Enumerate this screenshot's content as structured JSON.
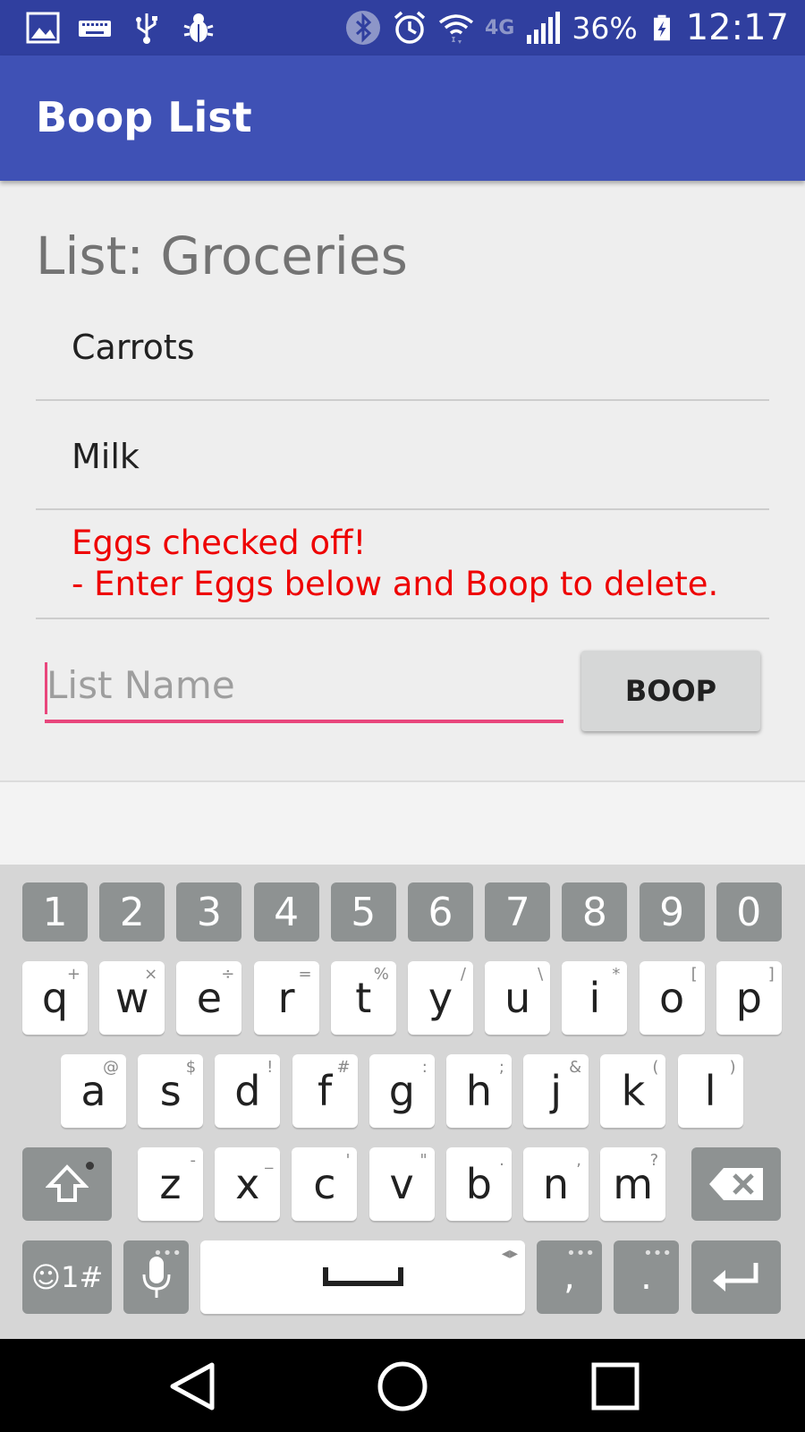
{
  "status_bar": {
    "left_icons": [
      "image-icon",
      "keyboard-icon",
      "usb-icon",
      "bug-icon"
    ],
    "right_icons": [
      "bluetooth-icon",
      "alarm-icon",
      "wifi-icon"
    ],
    "network": "4G",
    "battery_percent": "36%",
    "time": "12:17"
  },
  "app_bar": {
    "title": "Boop List"
  },
  "list": {
    "title": "List: Groceries",
    "items": [
      "Carrots",
      "Milk"
    ],
    "alert_line1": "Eggs checked off!",
    "alert_line2": "- Enter Eggs below and Boop to delete."
  },
  "input": {
    "placeholder": "List Name",
    "value": ""
  },
  "button": {
    "label": "BOOP"
  },
  "keyboard": {
    "numbers": [
      "1",
      "2",
      "3",
      "4",
      "5",
      "6",
      "7",
      "8",
      "9",
      "0"
    ],
    "row1": [
      [
        "q",
        "+"
      ],
      [
        "w",
        "×"
      ],
      [
        "e",
        "÷"
      ],
      [
        "r",
        "="
      ],
      [
        "t",
        "%"
      ],
      [
        "y",
        "/"
      ],
      [
        "u",
        "\\"
      ],
      [
        "i",
        "*"
      ],
      [
        "o",
        "["
      ],
      [
        "p",
        "]"
      ]
    ],
    "row2": [
      [
        "a",
        "@"
      ],
      [
        "s",
        "$"
      ],
      [
        "d",
        "!"
      ],
      [
        "f",
        "#"
      ],
      [
        "g",
        ":"
      ],
      [
        "h",
        ";"
      ],
      [
        "j",
        "&"
      ],
      [
        "k",
        "("
      ],
      [
        "l",
        ")"
      ]
    ],
    "row3": [
      [
        "z",
        "-"
      ],
      [
        "x",
        "_"
      ],
      [
        "c",
        "'"
      ],
      [
        "v",
        "\""
      ],
      [
        "b",
        "."
      ],
      [
        "n",
        ","
      ],
      [
        "m",
        "?"
      ]
    ],
    "symbols_label": "☺1#",
    "comma": ",",
    "period": "."
  },
  "colors": {
    "status_bar": "#303f9f",
    "app_bar": "#3f51b5",
    "accent": "#e8467c",
    "alert": "#ee0000"
  }
}
